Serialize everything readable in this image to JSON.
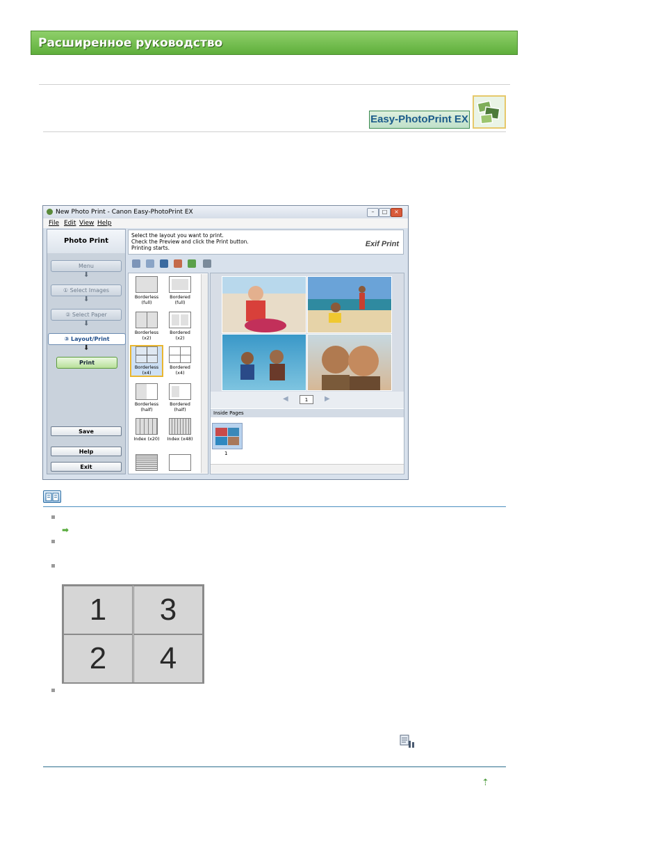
{
  "header": {
    "title": "Расширенное руководство"
  },
  "logo": {
    "text": "Easy-PhotoPrint EX"
  },
  "app": {
    "window_title": "New Photo Print - Canon Easy-PhotoPrint EX",
    "menus": [
      "File",
      "Edit",
      "View",
      "Help"
    ],
    "left_title": "Photo Print",
    "steps": {
      "menu": "Menu",
      "select_images": "① Select Images",
      "select_paper": "② Select Paper",
      "layout_print": "③ Layout/Print"
    },
    "print": "Print",
    "save": "Save",
    "help": "Help",
    "exit": "Exit",
    "instructions": [
      "Select the layout you want to print.",
      "Check the Preview and click the Print button.",
      "Printing starts."
    ],
    "exif": "Exif Print",
    "layouts": [
      [
        "Borderless",
        "(full)"
      ],
      [
        "Bordered (full)",
        ""
      ],
      [
        "Borderless",
        "(x2)"
      ],
      [
        "Bordered (x2)",
        ""
      ],
      [
        "Borderless",
        "(x4)"
      ],
      [
        "Bordered (x4)",
        ""
      ],
      [
        "Borderless",
        "(half)"
      ],
      [
        "Bordered",
        "(half)"
      ],
      [
        "Index (x20)",
        ""
      ],
      [
        "Index (x48)",
        ""
      ]
    ],
    "page_number": "1",
    "inside_pages": "Inside Pages",
    "thumb_number": "1"
  },
  "grid_numbers": [
    "1",
    "3",
    "2",
    "4"
  ]
}
